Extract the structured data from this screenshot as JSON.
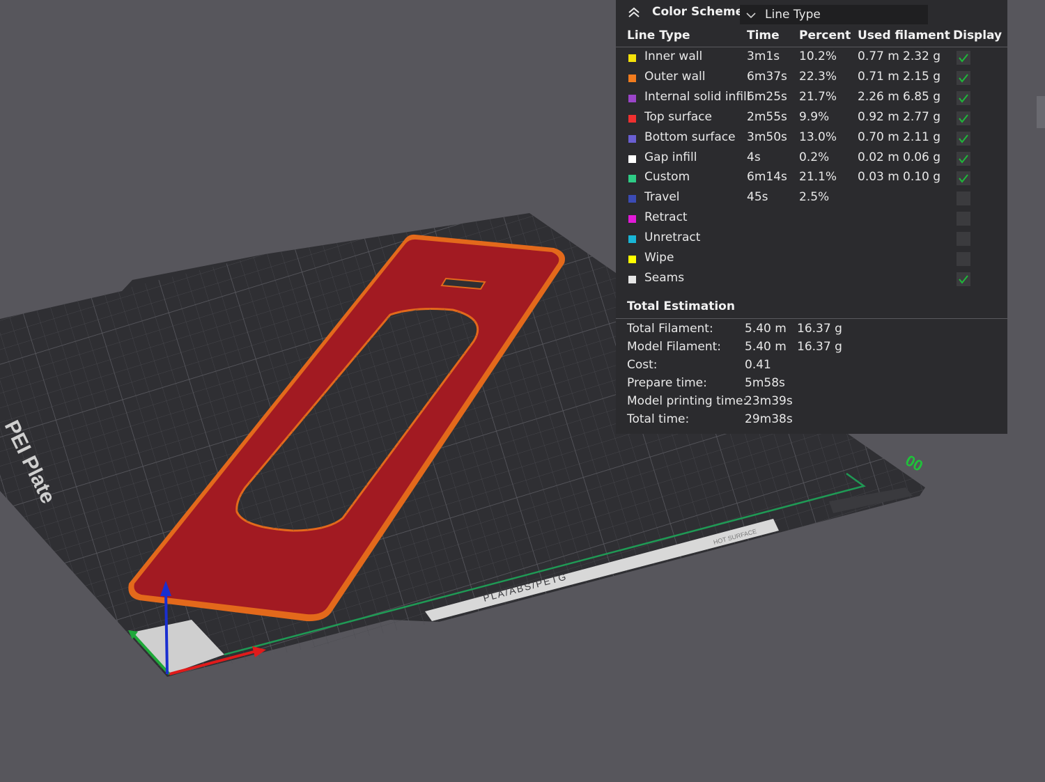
{
  "scene": {
    "plate_label": "PEI Plate",
    "plate_strip_text": "PLA/ABS/PETG",
    "hot_surface_text": "HOT SURFACE",
    "corner_mark": "00"
  },
  "panel": {
    "color_scheme_label": "Color Scheme",
    "color_scheme_value": "Line Type",
    "headers": {
      "line_type": "Line Type",
      "time": "Time",
      "percent": "Percent",
      "used_filament": "Used filament",
      "display": "Display"
    },
    "rows": [
      {
        "name": "Inner wall",
        "color": "#f5e20a",
        "time": "3m1s",
        "percent": "10.2%",
        "length": "0.77 m",
        "weight": "2.32 g",
        "display": true
      },
      {
        "name": "Outer wall",
        "color": "#f27c1e",
        "time": "6m37s",
        "percent": "22.3%",
        "length": "0.71 m",
        "weight": "2.15 g",
        "display": true
      },
      {
        "name": "Internal solid infill",
        "color": "#9b45c9",
        "time": "6m25s",
        "percent": "21.7%",
        "length": "2.26 m",
        "weight": "6.85 g",
        "display": true
      },
      {
        "name": "Top surface",
        "color": "#f03030",
        "time": "2m55s",
        "percent": "9.9%",
        "length": "0.92 m",
        "weight": "2.77 g",
        "display": true
      },
      {
        "name": "Bottom surface",
        "color": "#6a5fd2",
        "time": "3m50s",
        "percent": "13.0%",
        "length": "0.70 m",
        "weight": "2.11 g",
        "display": true
      },
      {
        "name": "Gap infill",
        "color": "#ffffff",
        "time": "4s",
        "percent": "0.2%",
        "length": "0.02 m",
        "weight": "0.06 g",
        "display": true
      },
      {
        "name": "Custom",
        "color": "#2ecc86",
        "time": "6m14s",
        "percent": "21.1%",
        "length": "0.03 m",
        "weight": "0.10 g",
        "display": true
      },
      {
        "name": "Travel",
        "color": "#3b4bb5",
        "time": "45s",
        "percent": "2.5%",
        "length": "",
        "weight": "",
        "display": false
      },
      {
        "name": "Retract",
        "color": "#e21ad8",
        "time": "",
        "percent": "",
        "length": "",
        "weight": "",
        "display": false
      },
      {
        "name": "Unretract",
        "color": "#19b6d6",
        "time": "",
        "percent": "",
        "length": "",
        "weight": "",
        "display": false
      },
      {
        "name": "Wipe",
        "color": "#ffff00",
        "time": "",
        "percent": "",
        "length": "",
        "weight": "",
        "display": false
      },
      {
        "name": "Seams",
        "color": "#e6e6e6",
        "time": "",
        "percent": "",
        "length": "",
        "weight": "",
        "display": true
      }
    ],
    "estimation": {
      "title": "Total Estimation",
      "rows": [
        {
          "label": "Total Filament:",
          "v1": "5.40 m",
          "v2": "16.37 g"
        },
        {
          "label": "Model Filament:",
          "v1": "5.40 m",
          "v2": "16.37 g"
        },
        {
          "label": "Cost:",
          "v1": "0.41",
          "v2": ""
        },
        {
          "label": "Prepare time:",
          "v1": "5m58s",
          "v2": ""
        },
        {
          "label": "Model printing time:",
          "v1": "23m39s",
          "v2": ""
        },
        {
          "label": "Total time:",
          "v1": "29m38s",
          "v2": ""
        }
      ]
    }
  },
  "colors": {
    "check": "#1fb83a",
    "model_red": "#a21a22",
    "model_orange": "#e3691b",
    "axis_x": "#e01b1b",
    "axis_y": "#1fa83a",
    "axis_z": "#1a2fd0"
  }
}
